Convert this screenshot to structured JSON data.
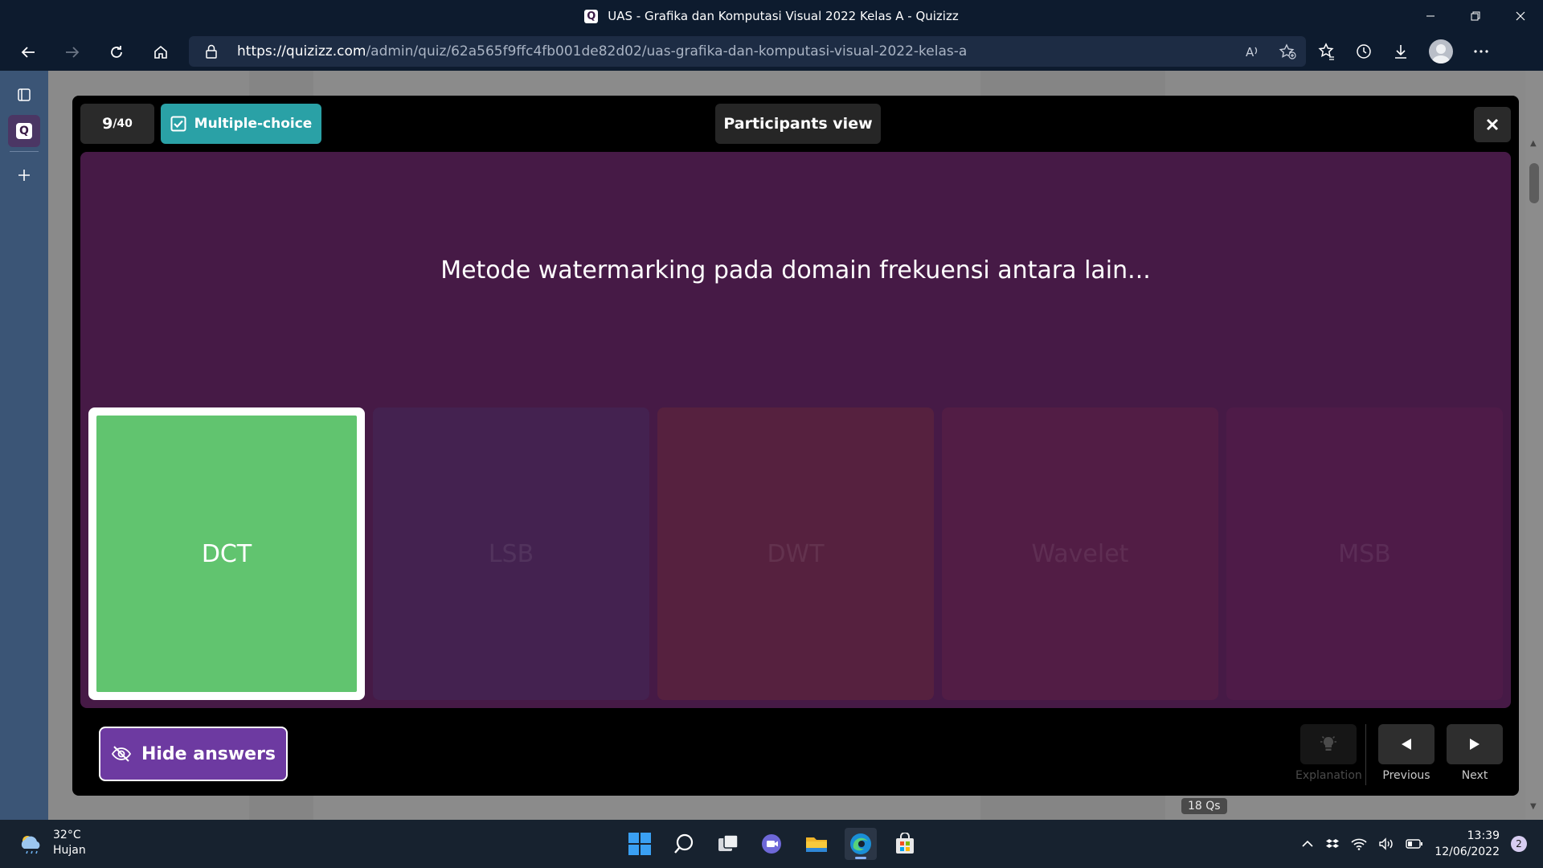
{
  "browser": {
    "window_title": "UAS - Grafika dan Komputasi Visual 2022 Kelas A - Quizizz",
    "url_host": "https://quizizz.com",
    "url_path": "/admin/quiz/62a565f9ffc4fb001de82d02/uas-grafika-dan-komputasi-visual-2022-kelas-a"
  },
  "modal": {
    "question_index": "9",
    "question_total": "/40",
    "question_type": "Multiple-choice",
    "participants_view_label": "Participants view",
    "question_text": "Metode watermarking pada domain frekuensi antara lain...",
    "options": [
      {
        "label": "DCT",
        "correct": true,
        "color": "#61c46f"
      },
      {
        "label": "LSB",
        "correct": false,
        "color": "#442250"
      },
      {
        "label": "DWT",
        "correct": false,
        "color": "#56213f"
      },
      {
        "label": "Wavelet",
        "correct": false,
        "color": "#521d45"
      },
      {
        "label": "MSB",
        "correct": false,
        "color": "#4e1b48"
      }
    ],
    "hide_answers_label": "Hide answers",
    "controls": {
      "explanation_label": "Explanation",
      "previous_label": "Previous",
      "next_label": "Next"
    }
  },
  "background_page": {
    "questions_badge": "18 Qs"
  },
  "taskbar": {
    "weather_temp": "32°C",
    "weather_desc": "Hujan",
    "time": "13:39",
    "date": "12/06/2022",
    "notification_count": "2"
  },
  "colors": {
    "accent_teal": "#2aa1a6",
    "accent_purple": "#6d3aa1",
    "question_bg": "#461a46",
    "correct_green": "#61c46f"
  }
}
